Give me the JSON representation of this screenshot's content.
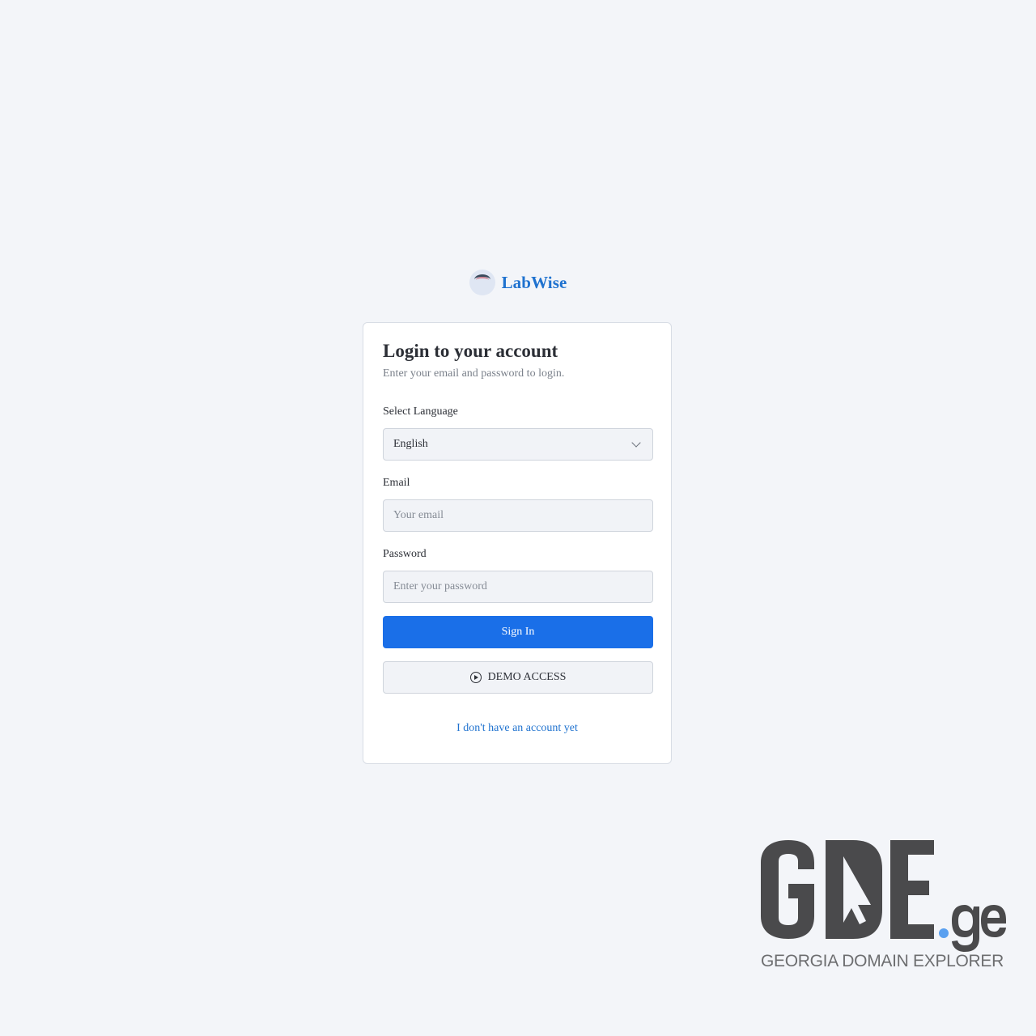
{
  "brand": {
    "name": "LabWise",
    "logo_icon": "labwise-logo-icon"
  },
  "login": {
    "title": "Login to your account",
    "subtitle": "Enter your email and password to login.",
    "language": {
      "label": "Select Language",
      "selected": "English"
    },
    "email": {
      "label": "Email",
      "placeholder": "Your email",
      "value": ""
    },
    "password": {
      "label": "Password",
      "placeholder": "Enter your password",
      "value": ""
    },
    "sign_in_label": "Sign In",
    "demo_label": "DEMO ACCESS",
    "demo_icon": "play-circle-icon",
    "signup_link": "I don't have an account yet"
  },
  "watermark": {
    "logo_text": "GDE.ge",
    "caption": "GEORGIA DOMAIN EXPLORER"
  },
  "colors": {
    "background": "#f3f5f9",
    "accent": "#1a6fe8",
    "link": "#1f72cf",
    "watermark_gray": "#4a4a4c",
    "watermark_dot": "#5aa0f0"
  }
}
